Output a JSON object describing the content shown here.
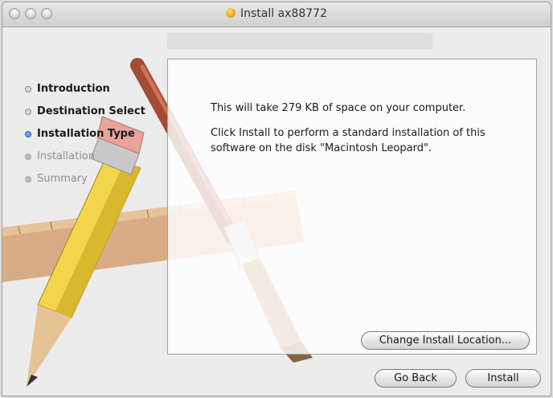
{
  "window": {
    "title": "Install ax88772",
    "title_icon": "package-icon"
  },
  "steps": [
    {
      "label": "Introduction",
      "state": "done"
    },
    {
      "label": "Destination Select",
      "state": "done"
    },
    {
      "label": "Installation Type",
      "state": "current"
    },
    {
      "label": "Installation",
      "state": "future"
    },
    {
      "label": "Summary",
      "state": "future"
    }
  ],
  "content": {
    "message_line1": "This will take 279 KB of space on your computer.",
    "message_line2": "Click Install to perform a standard installation of this software on the disk \"Macintosh Leopard\".",
    "change_location_label": "Change Install Location..."
  },
  "footer": {
    "back_label": "Go Back",
    "install_label": "Install"
  },
  "colors": {
    "current_step_bullet": "#6aa0ef",
    "window_bg": "#ececec"
  }
}
